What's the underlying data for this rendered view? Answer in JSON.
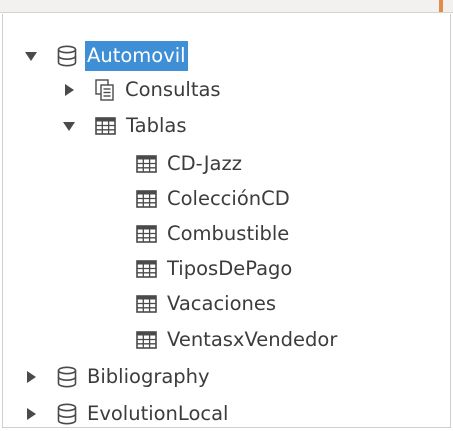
{
  "tree": {
    "databases": [
      {
        "label": "Automovil",
        "icon": "database-icon",
        "expanded": true,
        "selected": true,
        "children": [
          {
            "label": "Consultas",
            "icon": "queries-icon",
            "expanded": false
          },
          {
            "label": "Tablas",
            "icon": "table-icon",
            "expanded": true,
            "children": [
              {
                "label": "CD-Jazz",
                "icon": "table-icon"
              },
              {
                "label": "ColecciónCD",
                "icon": "table-icon"
              },
              {
                "label": "Combustible",
                "icon": "table-icon"
              },
              {
                "label": "TiposDePago",
                "icon": "table-icon"
              },
              {
                "label": "Vacaciones",
                "icon": "table-icon"
              },
              {
                "label": "VentasxVendedor",
                "icon": "table-icon"
              }
            ]
          }
        ]
      },
      {
        "label": "Bibliography",
        "icon": "database-icon",
        "expanded": false
      },
      {
        "label": "EvolutionLocal",
        "icon": "database-icon",
        "expanded": false
      }
    ]
  },
  "colors": {
    "selection": "#3f8fd6",
    "icon_stroke": "#4a4a4a",
    "text": "#3c3c3c"
  }
}
